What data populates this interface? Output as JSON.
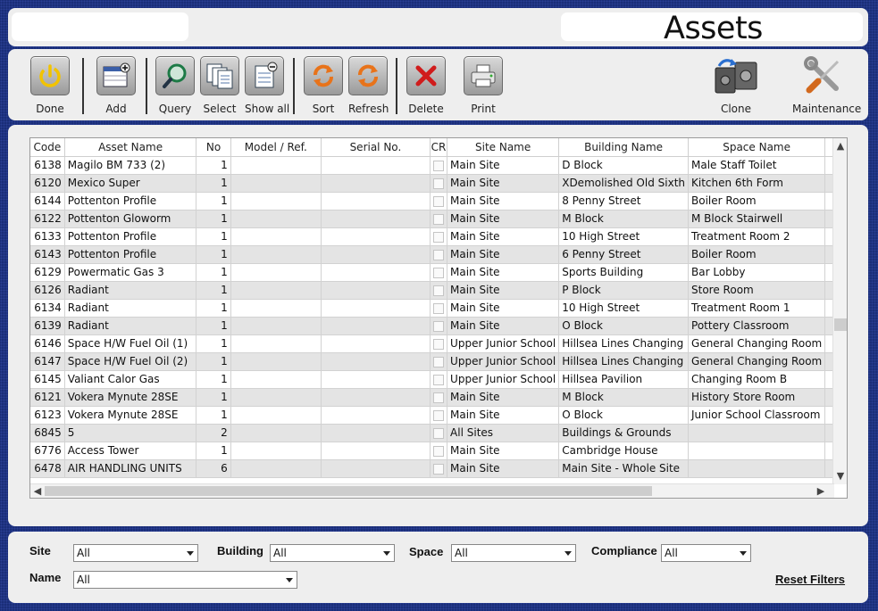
{
  "title": "Assets",
  "toolbar": {
    "done": "Done",
    "add": "Add",
    "query": "Query",
    "select": "Select",
    "show_all": "Show all",
    "sort": "Sort",
    "refresh": "Refresh",
    "delete": "Delete",
    "print": "Print",
    "clone": "Clone",
    "maintenance": "Maintenance"
  },
  "grid": {
    "columns": [
      "Code",
      "Asset Name",
      "No",
      "Model  / Ref.",
      "Serial No.",
      "CR",
      "Site Name",
      "Building Name",
      "Space Name"
    ],
    "rows": [
      {
        "code": "6138",
        "name": "Magilo BM 733         (2)",
        "no": "1",
        "model": "",
        "serial": "",
        "site": "Main Site",
        "building": "D Block",
        "space": "Male Staff Toilet"
      },
      {
        "code": "6120",
        "name": "Mexico Super",
        "no": "1",
        "model": "",
        "serial": "",
        "site": "Main Site",
        "building": "XDemolished Old Sixth",
        "space": "Kitchen 6th Form"
      },
      {
        "code": "6144",
        "name": "Pottenton   Profile",
        "no": "1",
        "model": "",
        "serial": "",
        "site": "Main Site",
        "building": "8 Penny Street",
        "space": "Boiler Room"
      },
      {
        "code": "6122",
        "name": "Pottenton Gloworm",
        "no": "1",
        "model": "",
        "serial": "",
        "site": "Main Site",
        "building": "M Block",
        "space": "M Block Stairwell"
      },
      {
        "code": "6133",
        "name": "Pottenton Profile",
        "no": "1",
        "model": "",
        "serial": "",
        "site": "Main Site",
        "building": "10 High Street",
        "space": "Treatment Room 2"
      },
      {
        "code": "6143",
        "name": "Pottenton Profile",
        "no": "1",
        "model": "",
        "serial": "",
        "site": "Main Site",
        "building": "6 Penny Street",
        "space": "Boiler Room"
      },
      {
        "code": "6129",
        "name": "Powermatic Gas 3",
        "no": "1",
        "model": "",
        "serial": "",
        "site": "Main Site",
        "building": "Sports Building",
        "space": "Bar Lobby"
      },
      {
        "code": "6126",
        "name": "Radiant",
        "no": "1",
        "model": "",
        "serial": "",
        "site": "Main Site",
        "building": "P Block",
        "space": "Store Room"
      },
      {
        "code": "6134",
        "name": "Radiant",
        "no": "1",
        "model": "",
        "serial": "",
        "site": "Main Site",
        "building": "10 High Street",
        "space": "Treatment Room 1"
      },
      {
        "code": "6139",
        "name": "Radiant",
        "no": "1",
        "model": "",
        "serial": "",
        "site": "Main Site",
        "building": "O Block",
        "space": "Pottery Classroom"
      },
      {
        "code": "6146",
        "name": "Space H/W    Fuel Oil (1)",
        "no": "1",
        "model": "",
        "serial": "",
        "site": "Upper Junior School",
        "building": "Hillsea Lines Changing",
        "space": "General Changing Room"
      },
      {
        "code": "6147",
        "name": "Space H/W    Fuel Oil (2)",
        "no": "1",
        "model": "",
        "serial": "",
        "site": "Upper Junior School",
        "building": "Hillsea Lines Changing",
        "space": "General Changing Room"
      },
      {
        "code": "6145",
        "name": "Valiant    Calor Gas",
        "no": "1",
        "model": "",
        "serial": "",
        "site": "Upper Junior School",
        "building": "Hillsea Pavilion",
        "space": "Changing Room B"
      },
      {
        "code": "6121",
        "name": "Vokera Mynute 28SE",
        "no": "1",
        "model": "",
        "serial": "",
        "site": "Main Site",
        "building": "M Block",
        "space": "History Store Room"
      },
      {
        "code": "6123",
        "name": "Vokera Mynute 28SE",
        "no": "1",
        "model": "",
        "serial": "",
        "site": "Main Site",
        "building": "O Block",
        "space": "Junior School Classroom"
      },
      {
        "code": "6845",
        "name": "5",
        "no": "2",
        "model": "",
        "serial": "",
        "site": "All Sites",
        "building": "Buildings & Grounds",
        "space": ""
      },
      {
        "code": "6776",
        "name": "Access Tower",
        "no": "1",
        "model": "",
        "serial": "",
        "site": "Main Site",
        "building": "Cambridge House",
        "space": ""
      },
      {
        "code": "6478",
        "name": "AIR HANDLING UNITS",
        "no": "6",
        "model": "",
        "serial": "",
        "site": "Main Site",
        "building": "Main Site - Whole Site",
        "space": ""
      }
    ]
  },
  "filters": {
    "site_label": "Site",
    "site_value": "All",
    "building_label": "Building",
    "building_value": "All",
    "space_label": "Space",
    "space_value": "All",
    "compliance_label": "Compliance",
    "compliance_value": "All",
    "name_label": "Name",
    "name_value": "All",
    "reset": "Reset Filters"
  }
}
